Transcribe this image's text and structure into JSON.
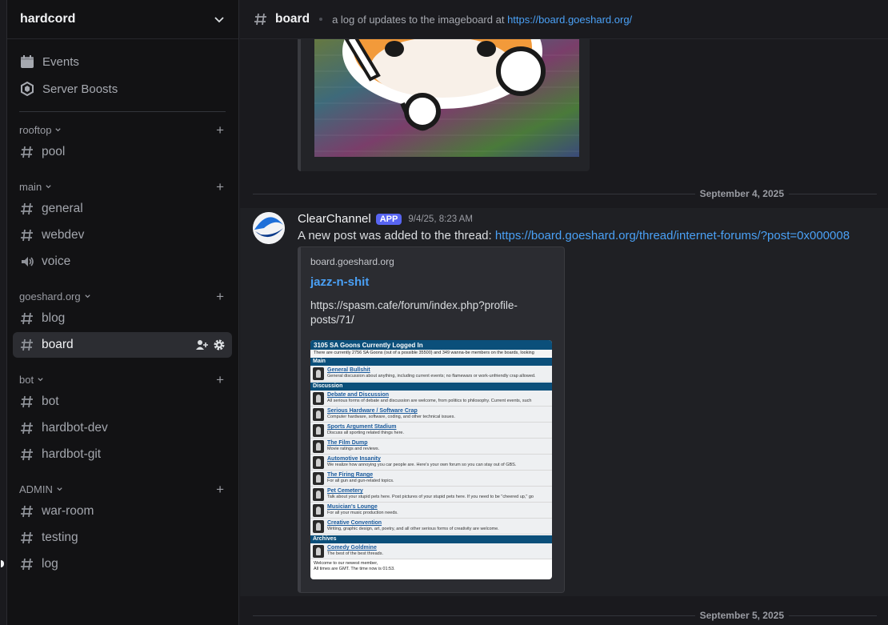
{
  "server": {
    "name": "hardcord"
  },
  "top_items": [
    {
      "label": "Events",
      "icon": "calendar-icon"
    },
    {
      "label": "Server Boosts",
      "icon": "boost-icon"
    }
  ],
  "categories": [
    {
      "name": "rooftop",
      "channels": [
        {
          "name": "pool",
          "type": "text"
        }
      ]
    },
    {
      "name": "main",
      "channels": [
        {
          "name": "general",
          "type": "text"
        },
        {
          "name": "webdev",
          "type": "text"
        },
        {
          "name": "voice",
          "type": "voice"
        }
      ]
    },
    {
      "name": "goeshard.org",
      "channels": [
        {
          "name": "blog",
          "type": "text"
        },
        {
          "name": "board",
          "type": "text",
          "active": true
        }
      ]
    },
    {
      "name": "bot",
      "channels": [
        {
          "name": "bot",
          "type": "text"
        },
        {
          "name": "hardbot-dev",
          "type": "text"
        },
        {
          "name": "hardbot-git",
          "type": "text"
        }
      ]
    },
    {
      "name": "ADMIN",
      "channels": [
        {
          "name": "war-room",
          "type": "text"
        },
        {
          "name": "testing",
          "type": "text"
        },
        {
          "name": "log",
          "type": "text",
          "unread": true
        }
      ]
    }
  ],
  "header": {
    "channel_name": "board",
    "topic_prefix": "a log of updates to the imageboard at ",
    "topic_link": "https://board.goeshard.org/"
  },
  "dividers": {
    "first": "September 4, 2025",
    "second": "September 5, 2025"
  },
  "message": {
    "author": "ClearChannel",
    "badge": "APP",
    "timestamp": "9/4/25, 8:23 AM",
    "text_prefix": "A new post was added to the thread: ",
    "link": "https://board.goeshard.org/thread/internet-forums/?post=0x000008",
    "embed": {
      "provider": "board.goeshard.org",
      "title": "jazz-n-shit",
      "description": "https://spasm.cafe/forum/index.php?profile-posts/71/"
    }
  },
  "forum": {
    "title": "3105 SA Goons Currently Logged In",
    "subline": "There are currently 2756 SA Goons (out of a possible 35500) and 349 wanna-be members on the boards, looking",
    "sections": [
      {
        "name": "Main",
        "forums": [
          {
            "name": "General Bullshit",
            "desc": "General discussion about anything, including current events; no flamewars or work-unfriendly crap allowed."
          }
        ]
      },
      {
        "name": "Discussion",
        "forums": [
          {
            "name": "Debate and Discussion",
            "desc": "All serious forms of debate and discussion are welcome, from politics to philosophy. Current events, such"
          },
          {
            "name": "Serious Hardware / Software Crap",
            "desc": "Computer hardware, software, coding, and other technical issues."
          },
          {
            "name": "Sports Argument Stadium",
            "desc": "Discuss all sporting related things here."
          },
          {
            "name": "The Film Dump",
            "desc": "Movie ratings and reviews."
          },
          {
            "name": "Automotive Insanity",
            "desc": "We realize how annoying you car people are. Here's your own forum so you can stay out of GBS."
          },
          {
            "name": "The Firing Range",
            "desc": "For all gun and gun-related topics."
          },
          {
            "name": "Pet Cemetery",
            "desc": "Talk about your stupid pets here. Post pictures of your stupid pets here. If you need to be \"cheered up,\" go"
          },
          {
            "name": "Musician's Lounge",
            "desc": "For all your music production needs."
          },
          {
            "name": "Creative Convention",
            "desc": "Writing, graphic design, art, poetry, and all other serious forms of creativity are welcome."
          }
        ]
      },
      {
        "name": "Archives",
        "forums": [
          {
            "name": "Comedy Goldmine",
            "desc": "The best of the best threads."
          }
        ]
      }
    ],
    "footer_1": "Welcome to our newest member,",
    "footer_2": "All times are GMT. The time now is 01:53."
  }
}
